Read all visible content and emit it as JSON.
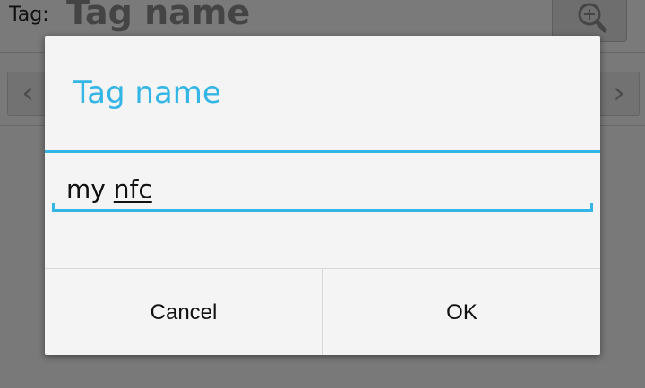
{
  "background": {
    "tag_label": "Tag:",
    "tag_name": "Tag name",
    "search_icon": "search-icon",
    "nav_prev": "‹",
    "nav_next": "›"
  },
  "dialog": {
    "title": "Tag name",
    "input": {
      "value_plain": "my ",
      "value_underlined": "nfc",
      "value": "my nfc"
    },
    "buttons": {
      "cancel": "Cancel",
      "ok": "OK"
    }
  },
  "colors": {
    "accent": "#33b5e5",
    "dialog_bg": "#f4f4f4",
    "scrim": "rgba(0,0,0,0.5)"
  }
}
